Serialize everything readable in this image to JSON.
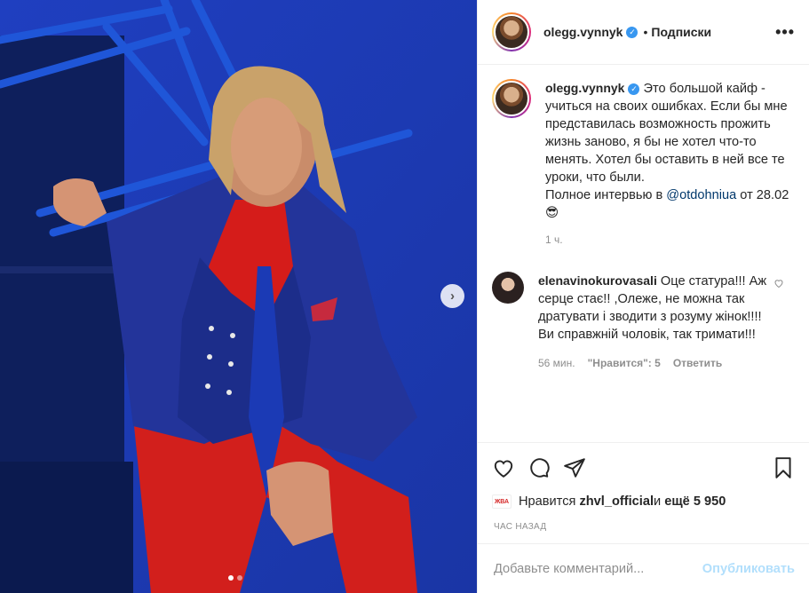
{
  "post": {
    "username": "olegg.vynnyk",
    "follow_label": "Подписки",
    "bullet": "•",
    "more_label": "•••",
    "verified_mark": "✓"
  },
  "caption": {
    "username": "olegg.vynnyk",
    "text": "Это большой кайф - учиться на своих ошибках. Если бы мне представилась возможность прожить жизнь заново, я бы не хотел что-то менять. Хотел бы оставить в ней все те уроки, что были.",
    "interview_prefix": "Полное интервью в ",
    "mention": "@otdohniua",
    "interview_suffix": " от 28.02 ",
    "emoji": "😎",
    "time": "1 ч."
  },
  "comments": [
    {
      "username": "elenavinokurovasali",
      "text": "Оце статура!!! Аж серце стає!! ,Олеже, не можна так дратувати і зводити з розуму жінок!!!! Ви справжній чоловік, так тримати!!!",
      "time": "56 мин.",
      "likes": "\"Нравится\": 5",
      "reply_label": "Ответить"
    }
  ],
  "likes": {
    "badge": "ЖВА",
    "prefix": "Нравится ",
    "user": "zhvl_official",
    "middle": " и ",
    "count": "ещё 5 950"
  },
  "post_time": "ЧАС НАЗАД",
  "add_comment": {
    "placeholder": "Добавьте комментарий...",
    "publish_label": "Опубликовать"
  },
  "icons": [
    "heart-icon",
    "comment-icon",
    "share-icon",
    "bookmark-icon",
    "chevron-right-icon",
    "more-icon"
  ],
  "colors": {
    "accent": "#3897f0",
    "publish": "#b2dffc",
    "photo_bg": "#1d3fb6"
  },
  "carousel": {
    "current": 1,
    "total": 2
  }
}
